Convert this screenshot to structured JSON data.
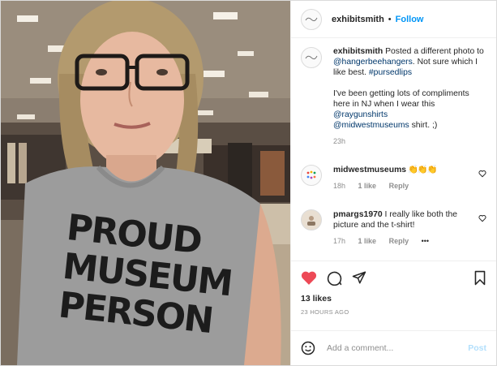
{
  "post": {
    "author": "exhibitsmith",
    "follow_label": "Follow",
    "separator": "•",
    "shirt_lines": [
      "PROUD",
      "MUSEUM",
      "PERSON"
    ]
  },
  "caption": {
    "username": "exhibitsmith",
    "text_1": " Posted a different photo to ",
    "mention_1": "@hangerbeehangers",
    "text_2": ". Not sure which I like best. ",
    "hashtag": "#pursedlips",
    "text_3": "I've been getting lots of compliments here in NJ when I wear this ",
    "mention_2": "@raygunshirts",
    "mention_3": "@midwestmuseums",
    "text_4": " shirt. ;)",
    "time": "23h"
  },
  "comments": [
    {
      "username": "midwestmuseums",
      "text": " 👏👏👏",
      "time": "18h",
      "likes": "1 like",
      "reply_label": "Reply"
    },
    {
      "username": "pmargs1970",
      "text": " I really like both the picture and the t-shirt!",
      "time": "17h",
      "likes": "1 like",
      "reply_label": "Reply",
      "more": "•••"
    }
  ],
  "engagement": {
    "likes": "13 likes",
    "timestamp": "23 HOURS AGO"
  },
  "composer": {
    "placeholder": "Add a comment...",
    "post_label": "Post"
  },
  "icons": {
    "like": "heart-filled-icon",
    "comment": "comment-bubble-icon",
    "share": "paper-plane-icon",
    "save": "bookmark-icon",
    "emoji": "smiley-icon",
    "comment_like": "heart-outline-icon"
  },
  "colors": {
    "heart": "#ed4956",
    "follow": "#0095f6",
    "link": "#00376b",
    "muted": "#8e8e8e",
    "post_disabled": "#b2dffc"
  }
}
